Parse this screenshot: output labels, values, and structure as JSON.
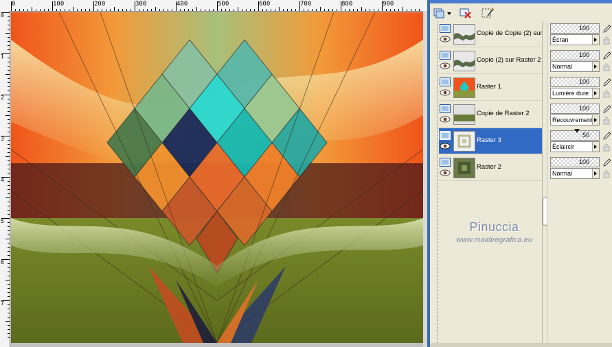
{
  "ruler": {
    "top_labels": [
      "0",
      "100",
      "200",
      "300",
      "400",
      "500",
      "600",
      "700",
      "800",
      "900"
    ],
    "left_labels": [
      "0",
      "1",
      "2",
      "3",
      "4",
      "5",
      "6",
      "7"
    ]
  },
  "canvas": {
    "description_icon": "artwork-canvas"
  },
  "toolbar": {
    "buttons": [
      "new-layer-dropdown-icon",
      "delete-layer-icon",
      "edit-selection-icon"
    ]
  },
  "layers": [
    {
      "name": "Copie de Copie (2) sur",
      "opacity": "100",
      "blend": "Écran",
      "selected": false,
      "thumb": "wave-dark"
    },
    {
      "name": "Copie (2) sur Raster 2",
      "opacity": "100",
      "blend": "Normal",
      "selected": false,
      "thumb": "wave-dark"
    },
    {
      "name": "Raster 1",
      "opacity": "100",
      "blend": "Lumière dure",
      "selected": false,
      "thumb": "art"
    },
    {
      "name": "Copie de Raster 2",
      "opacity": "100",
      "blend": "Recouvrement",
      "selected": false,
      "thumb": "band-green"
    },
    {
      "name": "Raster 3",
      "opacity": "50",
      "blend": "Éclaircir",
      "selected": true,
      "thumb": "frame-light"
    },
    {
      "name": "Raster 2",
      "opacity": "100",
      "blend": "Normal",
      "selected": false,
      "thumb": "frame-dark"
    }
  ],
  "watermark": {
    "name": "Pinuccia",
    "url": "www.maidiregrafica.eu"
  },
  "colors": {
    "selection": "#316ac5",
    "orange": "#f25a1c",
    "teal": "#1ec8c0",
    "olive": "#9aa63a"
  }
}
